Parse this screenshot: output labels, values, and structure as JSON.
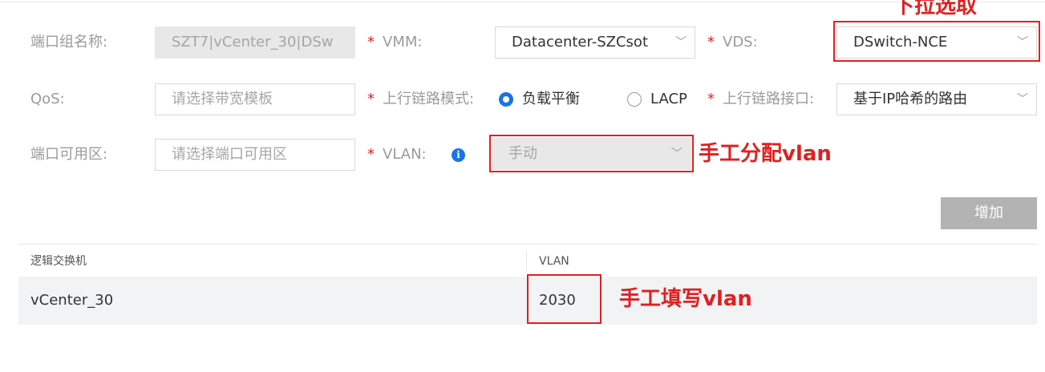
{
  "form": {
    "port_group_name": {
      "label": "端口组名称:",
      "value": "SZT7|vCenter_30|DSw"
    },
    "vmm": {
      "required": "*",
      "label": "VMM:",
      "value": "Datacenter-SZCsot"
    },
    "vds": {
      "required": "*",
      "label": "VDS:",
      "value": "DSwitch-NCE"
    },
    "qos": {
      "label": "QoS:",
      "placeholder": "请选择带宽模板"
    },
    "uplink_mode": {
      "required": "*",
      "label": "上行链路模式:",
      "options": [
        {
          "label": "负载平衡",
          "selected": true
        },
        {
          "label": "LACP",
          "selected": false
        }
      ]
    },
    "uplink_iface": {
      "required": "*",
      "label": "上行链路接口:",
      "value": "基于IP哈希的路由"
    },
    "port_zone": {
      "label": "端口可用区:",
      "placeholder": "请选择端口可用区"
    },
    "vlan": {
      "required": "*",
      "label": "VLAN:",
      "info_icon": "i",
      "value": "手动"
    },
    "add_button": "增加"
  },
  "table": {
    "columns": [
      "逻辑交换机",
      "VLAN"
    ],
    "rows": [
      {
        "switch": "vCenter_30",
        "vlan": "2030"
      }
    ]
  },
  "annotations": {
    "dropdown_select": "下拉选取",
    "manual_assign_vlan": "手工分配vlan",
    "manual_fill_vlan": "手工填写vlan"
  },
  "colors": {
    "annotation_red": "#e02020",
    "radio_blue": "#1a73e8",
    "disabled_gray": "#e8e8e8",
    "button_gray": "#b3b3b3"
  }
}
